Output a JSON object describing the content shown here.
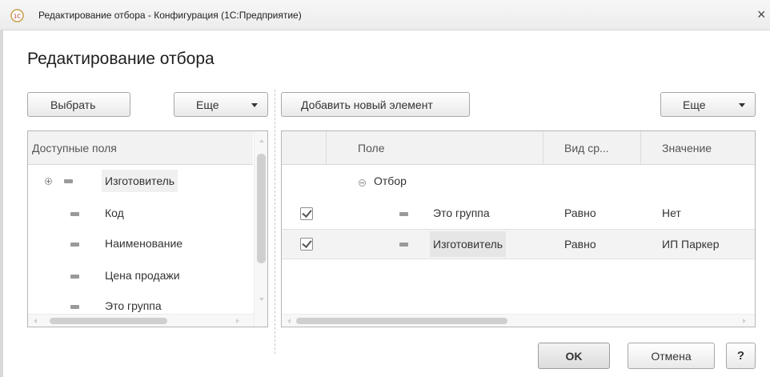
{
  "window": {
    "title": "Редактирование отбора - Конфигурация  (1С:Предприятие)",
    "close_glyph": "×",
    "app_icon": "1c-logo-icon"
  },
  "form": {
    "title": "Редактирование отбора"
  },
  "left_toolbar": {
    "select_label": "Выбрать",
    "more_label": "Еще"
  },
  "right_toolbar": {
    "add_label": "Добавить новый элемент",
    "more_label": "Еще"
  },
  "available_fields": {
    "header": "Доступные поля",
    "items": [
      {
        "label": "Изготовитель",
        "expandable": true,
        "highlighted": true
      },
      {
        "label": "Код",
        "expandable": false,
        "highlighted": false
      },
      {
        "label": "Наименование",
        "expandable": false,
        "highlighted": false
      },
      {
        "label": "Цена продажи",
        "expandable": false,
        "highlighted": false
      },
      {
        "label": "Это группа",
        "expandable": false,
        "highlighted": false
      }
    ]
  },
  "filter_table": {
    "columns": {
      "field": "Поле",
      "comparison": "Вид ср...",
      "value": "Значение"
    },
    "group_label": "Отбор",
    "rows": [
      {
        "checked": true,
        "field": "Это группа",
        "comparison": "Равно",
        "value": "Нет"
      },
      {
        "checked": true,
        "field": "Изготовитель",
        "comparison": "Равно",
        "value": "ИП Паркер"
      }
    ]
  },
  "footer": {
    "ok_label": "OK",
    "cancel_label": "Отмена",
    "help_label": "?"
  }
}
